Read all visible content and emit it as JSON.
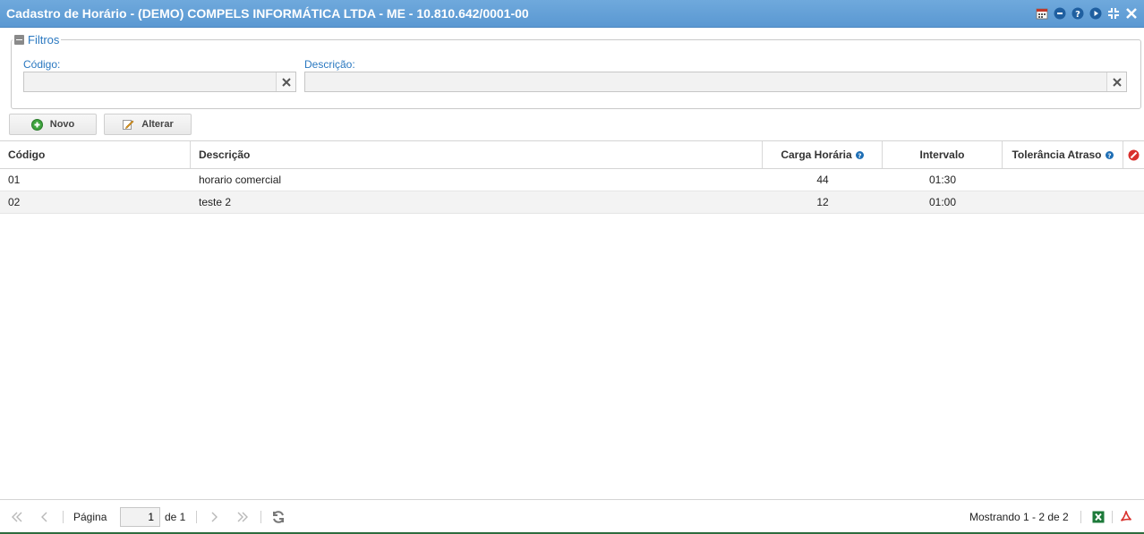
{
  "window": {
    "title": "Cadastro de Horário - (DEMO) COMPELS INFORMÁTICA LTDA - ME - 10.810.642/0001-00",
    "tools": [
      "calendar-icon",
      "minimize-icon",
      "help-icon",
      "play-icon",
      "restore-icon",
      "close-icon"
    ]
  },
  "filters": {
    "legend": "Filtros",
    "codigo_label": "Código:",
    "codigo_value": "",
    "descricao_label": "Descrição:",
    "descricao_value": ""
  },
  "toolbar": {
    "novo_label": "Novo",
    "alterar_label": "Alterar"
  },
  "grid": {
    "columns": {
      "codigo": "Código",
      "descricao": "Descrição",
      "carga": "Carga Horária",
      "intervalo": "Intervalo",
      "tolerancia": "Tolerância Atraso"
    },
    "rows": [
      {
        "codigo": "01",
        "descricao": "horario comercial",
        "carga": "44",
        "intervalo": "01:30",
        "tolerancia": ""
      },
      {
        "codigo": "02",
        "descricao": "teste 2",
        "carga": "12",
        "intervalo": "01:00",
        "tolerancia": ""
      }
    ]
  },
  "paging": {
    "page_label": "Página",
    "current_page": "1",
    "of_label": "de 1",
    "showing": "Mostrando 1 - 2 de 2"
  },
  "colors": {
    "titlebar": "#5a98d2",
    "accent": "#2a78c0",
    "help": "#1f6fb5",
    "excel": "#1d7a3a",
    "pdf": "#d9302c"
  }
}
